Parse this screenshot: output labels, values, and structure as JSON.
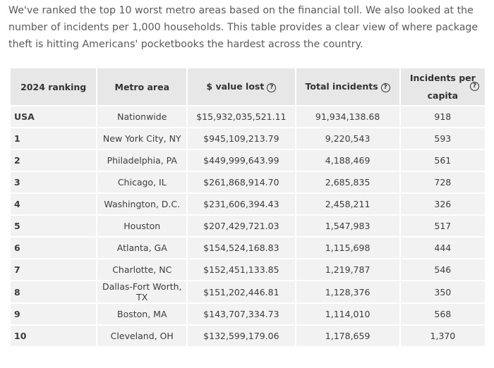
{
  "intro_text": "We've ranked the top 10 worst metro areas based on the financial toll. We also looked at the number of incidents per 1,000 households. This table provides a clear view of where package theft is hitting Americans' pocketbooks the hardest across the country.",
  "table": {
    "headers": {
      "ranking": "2024 ranking",
      "metro": "Metro area",
      "value_lost": "$ value lost",
      "total_incidents": "Total incidents",
      "per_capita": "Incidents per capita"
    },
    "help_icon": "question-circle-icon",
    "rows": [
      {
        "rank": "USA",
        "metro": "Nationwide",
        "value": "$15,932,035,521.11",
        "incidents": "91,934,138.68",
        "capita": "918"
      },
      {
        "rank": "1",
        "metro": "New York City, NY",
        "value": "$945,109,213.79",
        "incidents": "9,220,543",
        "capita": "593"
      },
      {
        "rank": "2",
        "metro": "Philadelphia, PA",
        "value": "$449,999,643.99",
        "incidents": "4,188,469",
        "capita": "561"
      },
      {
        "rank": "3",
        "metro": "Chicago, IL",
        "value": "$261,868,914.70",
        "incidents": "2,685,835",
        "capita": "728"
      },
      {
        "rank": "4",
        "metro": "Washington, D.C.",
        "value": "$231,606,394.43",
        "incidents": "2,458,211",
        "capita": "326"
      },
      {
        "rank": "5",
        "metro": "Houston",
        "value": "$207,429,721.03",
        "incidents": "1,547,983",
        "capita": "517"
      },
      {
        "rank": "6",
        "metro": "Atlanta, GA",
        "value": "$154,524,168.83",
        "incidents": "1,115,698",
        "capita": "444"
      },
      {
        "rank": "7",
        "metro": "Charlotte, NC",
        "value": "$152,451,133.85",
        "incidents": "1,219,787",
        "capita": "546"
      },
      {
        "rank": "8",
        "metro": "Dallas-Fort Worth, TX",
        "value": "$151,202,446.81",
        "incidents": "1,128,376",
        "capita": "350"
      },
      {
        "rank": "9",
        "metro": "Boston, MA",
        "value": "$143,707,334.73",
        "incidents": "1,114,010",
        "capita": "568"
      },
      {
        "rank": "10",
        "metro": "Cleveland, OH",
        "value": "$132,599,179.06",
        "incidents": "1,178,659",
        "capita": "1,370"
      }
    ]
  }
}
